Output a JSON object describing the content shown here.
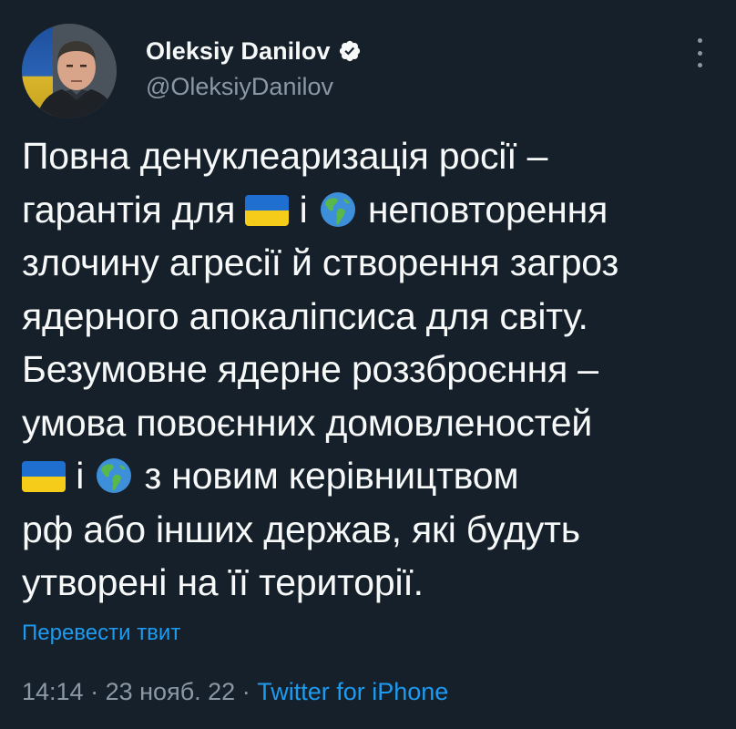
{
  "author": {
    "display_name": "Oleksiy Danilov",
    "handle": "@OleksiyDanilov",
    "verified": true
  },
  "tweet": {
    "lines": [
      [
        {
          "t": "text",
          "v": "Повна денуклеаризація росії –"
        }
      ],
      [
        {
          "t": "text",
          "v": "гарантія для "
        },
        {
          "t": "emoji",
          "v": "flag-ukraine-emoji"
        },
        {
          "t": "text",
          "v": " і "
        },
        {
          "t": "emoji",
          "v": "globe-americas-emoji"
        },
        {
          "t": "text",
          "v": " неповторення"
        }
      ],
      [
        {
          "t": "text",
          "v": "злочину агресії й створення загроз"
        }
      ],
      [
        {
          "t": "text",
          "v": "ядерного апокаліпсиса для світу."
        }
      ],
      [
        {
          "t": "text",
          "v": "Безумовне ядерне роззброєння –"
        }
      ],
      [
        {
          "t": "text",
          "v": "умова повоєнних домовленостей"
        }
      ],
      [
        {
          "t": "emoji",
          "v": "flag-ukraine-emoji"
        },
        {
          "t": "text",
          "v": " і "
        },
        {
          "t": "emoji",
          "v": "globe-americas-emoji"
        },
        {
          "t": "text",
          "v": " з новим керівництвом"
        }
      ],
      [
        {
          "t": "text",
          "v": "рф або інших держав, які будуть"
        }
      ],
      [
        {
          "t": "text",
          "v": "утворені на її території."
        }
      ]
    ],
    "translate_label": "Перевести твит",
    "time": "14:14",
    "date": "23 нояб. 22",
    "separator": "·",
    "source": "Twitter for iPhone"
  },
  "colors": {
    "background": "#15202b",
    "text": "#f7f9f9",
    "secondary": "#8b98a5",
    "link": "#1d9bf0"
  },
  "icons": {
    "verified": "verified-badge-icon",
    "more": "more-options-icon"
  }
}
